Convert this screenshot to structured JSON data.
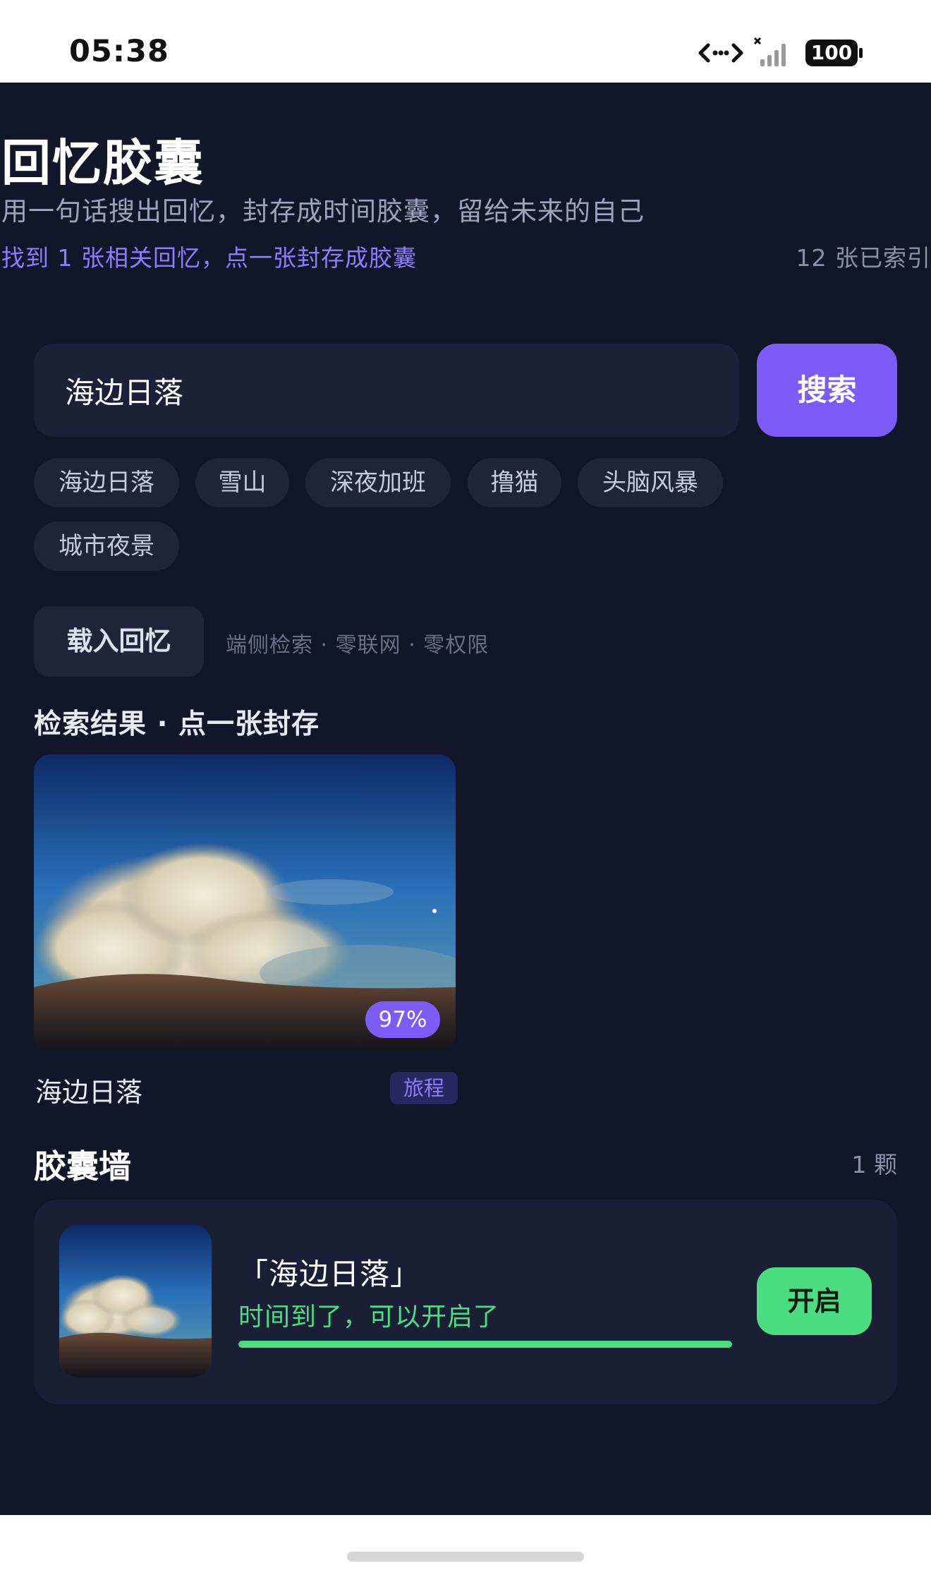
{
  "status_bar": {
    "time": "05:38",
    "battery": "100"
  },
  "header": {
    "title": "回忆胶囊",
    "subtitle": "用一句话搜出回忆，封存成时间胶囊，留给未来的自己",
    "found_text": "找到 1 张相关回忆，点一张封存成胶囊",
    "indexed_text": "12 张已索引"
  },
  "search": {
    "value": "海边日落",
    "button_label": "搜索"
  },
  "chips": [
    "海边日落",
    "雪山",
    "深夜加班",
    "撸猫",
    "头脑风暴",
    "城市夜景"
  ],
  "load": {
    "button_label": "载入回忆",
    "privacy_text": "端侧检索 · 零联网 · 零权限"
  },
  "results": {
    "section_title": "检索结果 · 点一张封存",
    "items": [
      {
        "title": "海边日落",
        "match": "97%",
        "tag": "旅程"
      }
    ]
  },
  "capsule_wall": {
    "title": "胶囊墙",
    "count": "1 颗",
    "items": [
      {
        "title": "「海边日落」",
        "status": "时间到了，可以开启了",
        "progress": 1.0,
        "button_label": "开启"
      }
    ]
  },
  "colors": {
    "accent": "#7c5cf8",
    "success": "#4ade80",
    "background": "#131629"
  }
}
